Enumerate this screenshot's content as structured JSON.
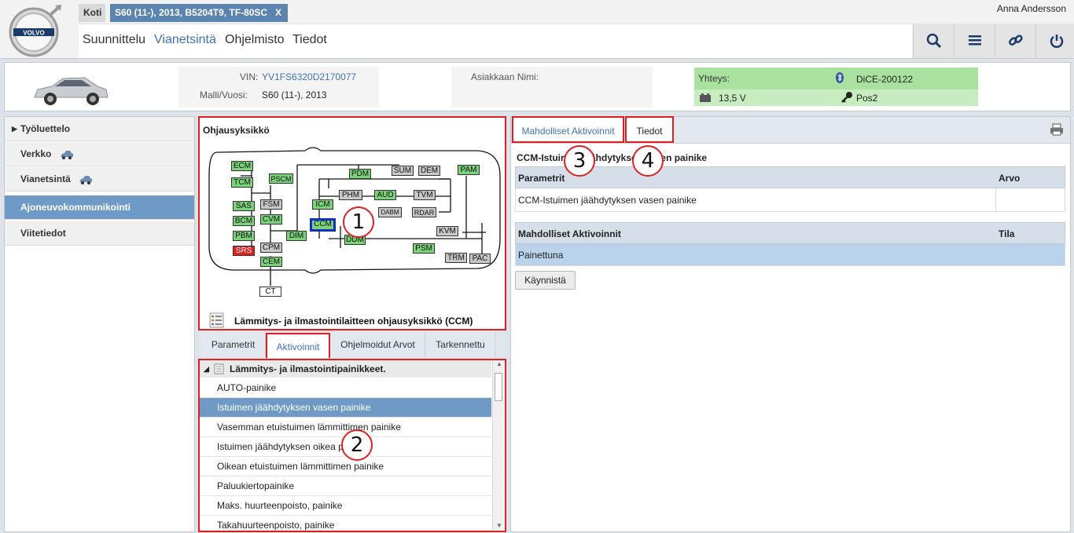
{
  "header": {
    "brand": "VOLVO",
    "tabs": {
      "home": "Koti",
      "vehicle": "S60 (11-), 2013, B5204T9, TF-80SC",
      "close": "X"
    },
    "nav": [
      "Suunnittelu",
      "Vianetsintä",
      "Ohjelmisto",
      "Tiedot"
    ],
    "active_nav": "Vianetsintä",
    "user": "Anna Andersson",
    "tools": [
      "search-icon",
      "list-icon",
      "link-icon",
      "power-icon"
    ]
  },
  "vehicle": {
    "vin_label": "VIN:",
    "vin": "YV1FS6320D2170077",
    "model_label": "Malli/Vuosi:",
    "model": "S60 (11-), 2013",
    "customer_label": "Asiakkaan Nimi:",
    "connection_label": "Yhteys:",
    "device": "DiCE-200122",
    "voltage": "13,5 V",
    "key_position": "Pos2"
  },
  "sidebar": {
    "items": [
      {
        "label": "Työluettelo",
        "icon": "triangle-right-icon"
      },
      {
        "label": "Verkko",
        "icon": "car-icon"
      },
      {
        "label": "Vianetsintä",
        "icon": "car-icon"
      },
      {
        "label": "Ajoneuvokommunikointi",
        "active": true
      },
      {
        "label": "Viitetiedot"
      }
    ]
  },
  "ecu_panel": {
    "title": "Ohjausyksikkö",
    "units": {
      "ECM": "ECM",
      "TCM": "TCM",
      "PSCM": "PSCM",
      "SAS": "SAS",
      "BCM": "BCM",
      "PBM": "PBM",
      "SRS": "SRS",
      "FSM": "FSM",
      "CVM": "CVM",
      "CPM": "CPM",
      "CEM": "CEM",
      "CT": "CT",
      "DIM": "DIM",
      "ICM": "ICM",
      "CCM": "CCM",
      "PDM": "PDM",
      "PHM": "PHM",
      "AUD": "AUD",
      "TVM": "TVM",
      "DABM": "DABM",
      "RDAR": "RDAR",
      "DDM": "DDM",
      "SUM": "SUM",
      "DEM": "DEM",
      "PAM": "PAM",
      "KVM": "KVM",
      "PSM": "PSM",
      "TRM": "TRM",
      "PAC": "PAC"
    },
    "caption": "Lämmitys- ja ilmastointilaitteen ohjausyksikkö (CCM)"
  },
  "mid_tabs": [
    "Parametrit",
    "Aktivoinnit",
    "Ohjelmoidut Arvot",
    "Tarkennettu"
  ],
  "activation_list": {
    "group": "Lämmitys- ja ilmastointipainikkeet.",
    "items": [
      "AUTO-painike",
      "Istuimen jäähdytyksen vasen painike",
      "Vasemman etuistuimen lämmittimen painike",
      "Istuimen jäähdytyksen oikea painike",
      "Oikean etuistuimen lämmittimen painike",
      "Paluukiertopainike",
      "Maks. huurteenpoisto, painike",
      "Takahuurteenpoisto, painike"
    ],
    "selected_index": 1
  },
  "right": {
    "tabs": [
      "Mahdolliset Aktivoinnit",
      "Tiedot"
    ],
    "title": "CCM-Istuimen jäähdytyksen vasen painike",
    "param_table": {
      "headers": [
        "Parametrit",
        "Arvo"
      ],
      "rows": [
        [
          "CCM-Istuimen jäähdytyksen vasen painike",
          ""
        ]
      ]
    },
    "act_table": {
      "headers": [
        "Mahdolliset Aktivoinnit",
        "Tila"
      ],
      "rows": [
        [
          "Painettuna",
          ""
        ]
      ]
    },
    "start_button": "Käynnistä"
  },
  "callouts": [
    "1",
    "2",
    "3",
    "4"
  ],
  "colors": {
    "accent": "#3f72b4",
    "selected": "#6f9ac6",
    "highlight": "#e02020",
    "ecu_ok": "#7ad27a",
    "ecu_fault": "#e02020"
  }
}
